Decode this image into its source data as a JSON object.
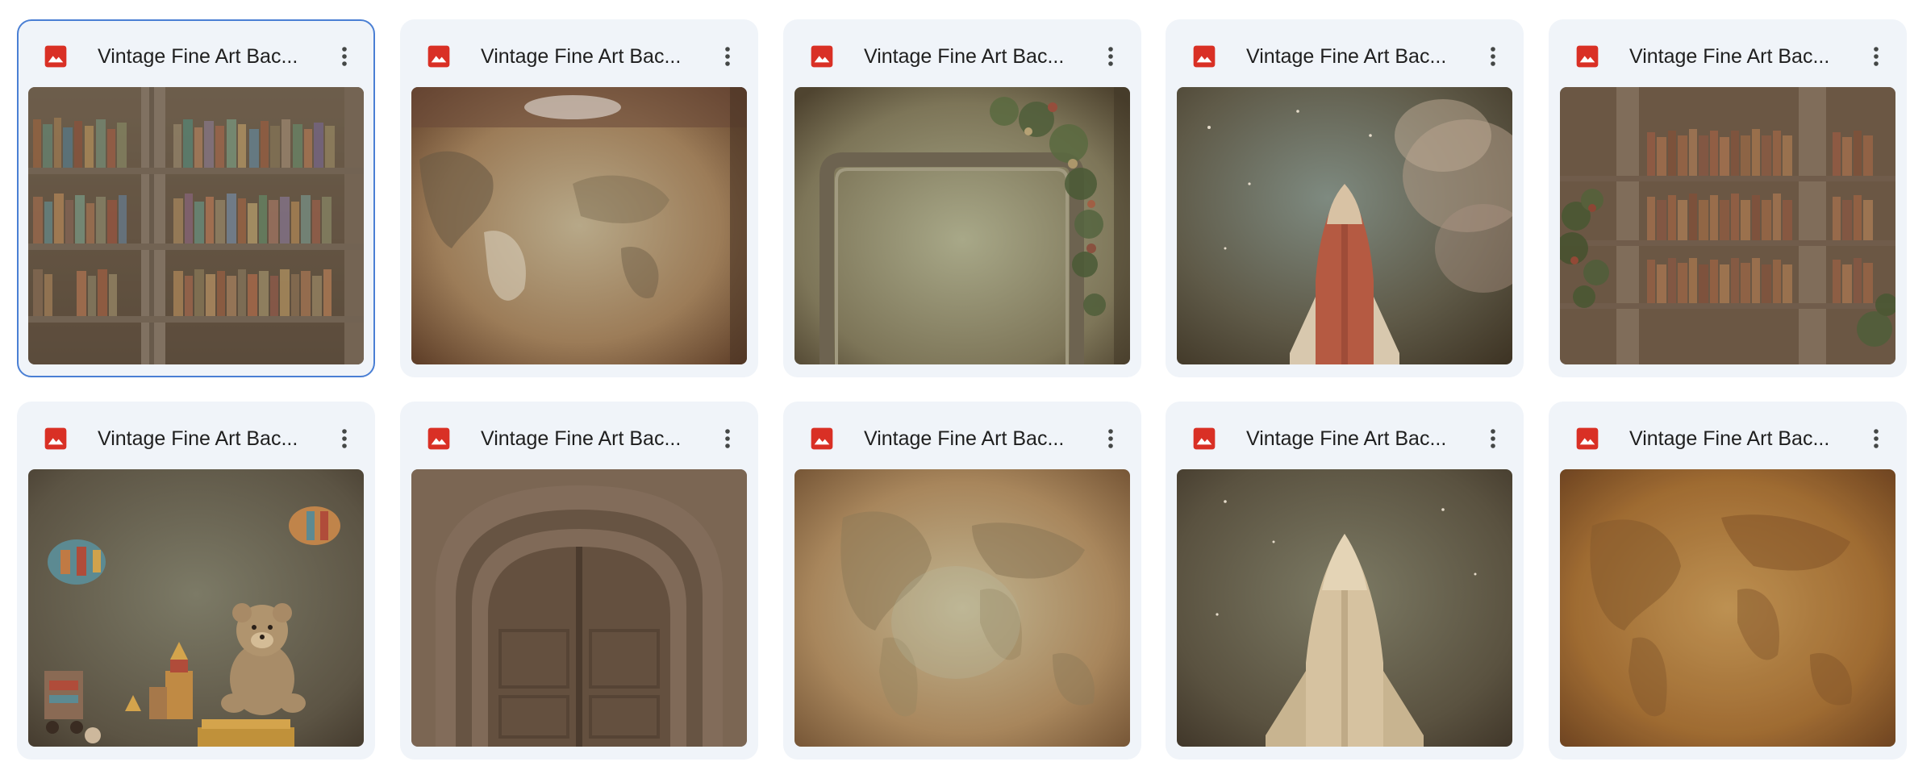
{
  "files": [
    {
      "title": "Vintage Fine Art Bac...",
      "icon": "image-file-icon",
      "thumbnail": "bookshelf-thumbnail",
      "selected": true
    },
    {
      "title": "Vintage Fine Art Bac...",
      "icon": "image-file-icon",
      "thumbnail": "world-map-wall-thumbnail",
      "selected": false
    },
    {
      "title": "Vintage Fine Art Bac...",
      "icon": "image-file-icon",
      "thumbnail": "floral-frame-thumbnail",
      "selected": false
    },
    {
      "title": "Vintage Fine Art Bac...",
      "icon": "image-file-icon",
      "thumbnail": "red-rocket-thumbnail",
      "selected": false
    },
    {
      "title": "Vintage Fine Art Bac...",
      "icon": "image-file-icon",
      "thumbnail": "bookshelf-plant-thumbnail",
      "selected": false
    },
    {
      "title": "Vintage Fine Art Bac...",
      "icon": "image-file-icon",
      "thumbnail": "teddy-bear-toys-thumbnail",
      "selected": false
    },
    {
      "title": "Vintage Fine Art Bac...",
      "icon": "image-file-icon",
      "thumbnail": "arched-door-thumbnail",
      "selected": false
    },
    {
      "title": "Vintage Fine Art Bac...",
      "icon": "image-file-icon",
      "thumbnail": "world-map-parchment-thumbnail",
      "selected": false
    },
    {
      "title": "Vintage Fine Art Bac...",
      "icon": "image-file-icon",
      "thumbnail": "cream-rocket-thumbnail",
      "selected": false
    },
    {
      "title": "Vintage Fine Art Bac...",
      "icon": "image-file-icon",
      "thumbnail": "golden-map-thumbnail",
      "selected": false
    }
  ],
  "colors": {
    "card_bg": "#f0f4f9",
    "selected_border": "#4a7fd4",
    "image_icon_red": "#d93025",
    "title_text": "#1f1f1f"
  }
}
